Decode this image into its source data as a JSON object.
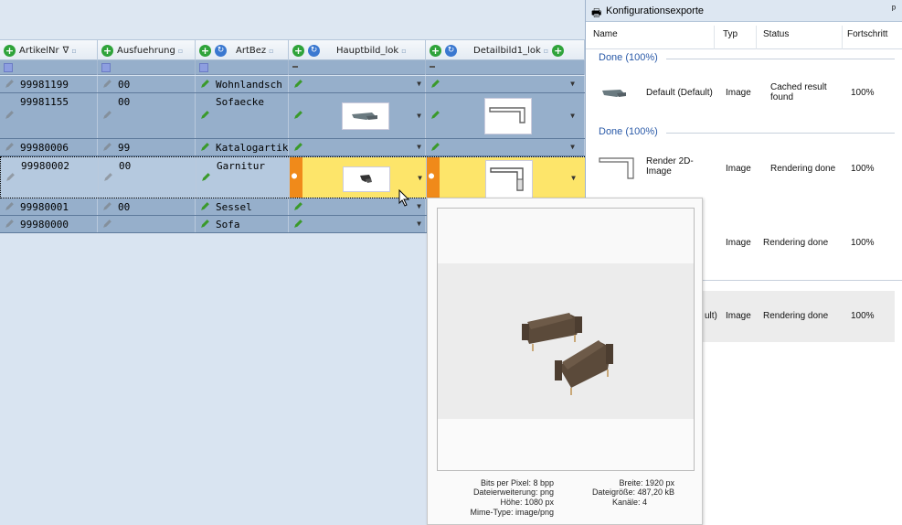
{
  "grid": {
    "columns": [
      {
        "label": "ArtikelNr",
        "filter_icon": "∇"
      },
      {
        "label": "Ausfuehrung"
      },
      {
        "label": "ArtBez"
      },
      {
        "label": "Hauptbild_lok"
      },
      {
        "label": "Detailbild1_lok"
      }
    ],
    "rows": [
      {
        "artikelnr": "99981199",
        "ausfuehrung": "00",
        "artbez": "Wohnlandsch"
      },
      {
        "artikelnr": "99981155",
        "ausfuehrung": "00",
        "artbez": "Sofaecke"
      },
      {
        "artikelnr": "99980006",
        "ausfuehrung": "99",
        "artbez": "Katalogartikel"
      },
      {
        "artikelnr": "99980002",
        "ausfuehrung": "00",
        "artbez": "Garnitur"
      },
      {
        "artikelnr": "99980001",
        "ausfuehrung": "00",
        "artbez": "Sessel"
      },
      {
        "artikelnr": "99980000",
        "ausfuehrung": "",
        "artbez": "Sofa"
      }
    ]
  },
  "panel": {
    "title": "Konfigurationsexporte",
    "pin": "ᵖ",
    "headers": {
      "name": "Name",
      "typ": "Typ",
      "status": "Status",
      "fortschritt": "Fortschritt"
    },
    "groups": [
      {
        "label": "Done (100%)",
        "item": {
          "name": "Default (Default)",
          "typ": "Image",
          "status": "Cached result found",
          "fortschritt": "100%"
        }
      },
      {
        "label": "Done (100%)",
        "item": {
          "name": "Render 2D-Image",
          "typ": "Image",
          "status": "Rendering done",
          "fortschritt": "100%"
        }
      }
    ],
    "extra_rows": [
      {
        "name_fragment": "",
        "typ": "Image",
        "status": "Rendering done",
        "fortschritt": "100%"
      },
      {
        "name_fragment": "ult)",
        "typ": "Image",
        "status": "Rendering done",
        "fortschritt": "100%"
      }
    ]
  },
  "popup": {
    "bits_per_pixel": "Bits per Pixel: 8 bpp",
    "dateierweiterung": "Dateierweiterung: png",
    "hoehe": "Höhe: 1080 px",
    "mime": "Mime-Type: image/png",
    "breite": "Breite: 1920 px",
    "dateigroesse": "Dateigröße: 487,20 kB",
    "kanaele": "Kanäle: 4"
  },
  "colors": {
    "grid_bg": "#d9e4f1",
    "row_bg": "#96afcb",
    "selected_highlight": "#fde56a",
    "accent_orange": "#f08a1a",
    "group_text": "#2a5aa8"
  },
  "icons": {
    "add": "plus-circle-icon",
    "refresh": "refresh-icon",
    "edit": "pencil-icon",
    "user": "user-icon",
    "pin": "pin-icon"
  }
}
